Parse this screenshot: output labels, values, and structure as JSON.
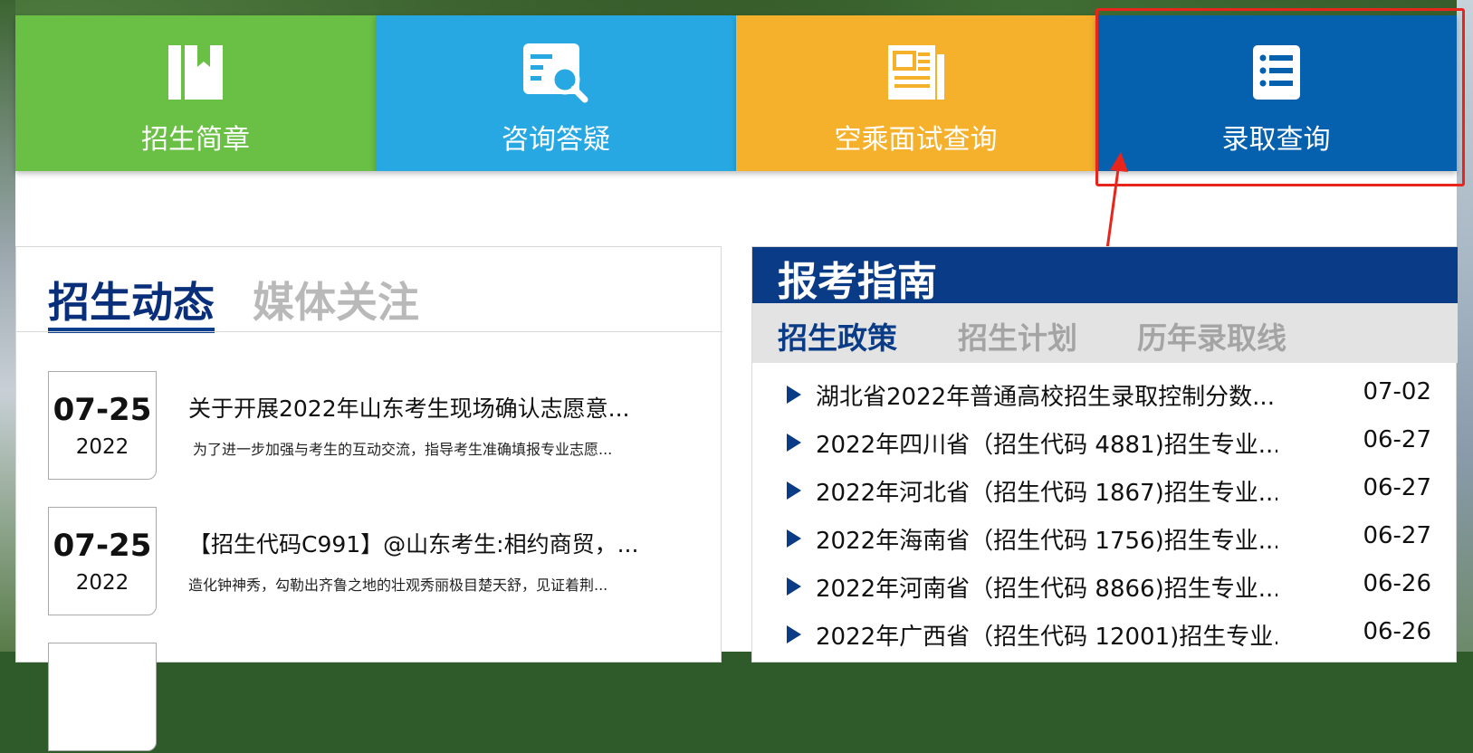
{
  "tiles": [
    {
      "label": "招生简章",
      "icon": "book-icon",
      "color": "#6abf45"
    },
    {
      "label": "咨询答疑",
      "icon": "search-doc-icon",
      "color": "#27a8e3"
    },
    {
      "label": "空乘面试查询",
      "icon": "newspaper-icon",
      "color": "#f5b12c"
    },
    {
      "label": "录取查询",
      "icon": "list-icon",
      "color": "#0561ae"
    }
  ],
  "news": {
    "tabs": [
      {
        "label": "招生动态",
        "active": true
      },
      {
        "label": "媒体关注",
        "active": false
      }
    ],
    "items": [
      {
        "date": "07-25",
        "year": "2022",
        "title": "关于开展2022年山东考生现场确认志愿意...",
        "desc": "为了进一步加强与考生的互动交流，指导考生准确填报专业志愿..."
      },
      {
        "date": "07-25",
        "year": "2022",
        "title": "【招生代码C991】@山东考生:相约商贸，...",
        "desc": "造化钟神秀，勾勒出齐鲁之地的壮观秀丽极目楚天舒，见证着荆..."
      }
    ]
  },
  "guide": {
    "title": "报考指南",
    "tabs": [
      {
        "label": "招生政策",
        "active": true
      },
      {
        "label": "招生计划",
        "active": false
      },
      {
        "label": "历年录取线",
        "active": false
      }
    ],
    "items": [
      {
        "title": "湖北省2022年普通高校招生录取控制分数...",
        "date": "07-02"
      },
      {
        "title": "2022年四川省（招生代码 4881)招生专业...",
        "date": "06-27"
      },
      {
        "title": "2022年河北省（招生代码 1867)招生专业...",
        "date": "06-27"
      },
      {
        "title": "2022年海南省（招生代码 1756)招生专业...",
        "date": "06-27"
      },
      {
        "title": "2022年河南省（招生代码 8866)招生专业...",
        "date": "06-26"
      },
      {
        "title": "2022年广西省（招生代码 12001)招生专业...",
        "date": "06-26"
      }
    ]
  },
  "accent": {
    "highlight_box": "#e8251c",
    "brand_blue": "#0a3b86"
  }
}
